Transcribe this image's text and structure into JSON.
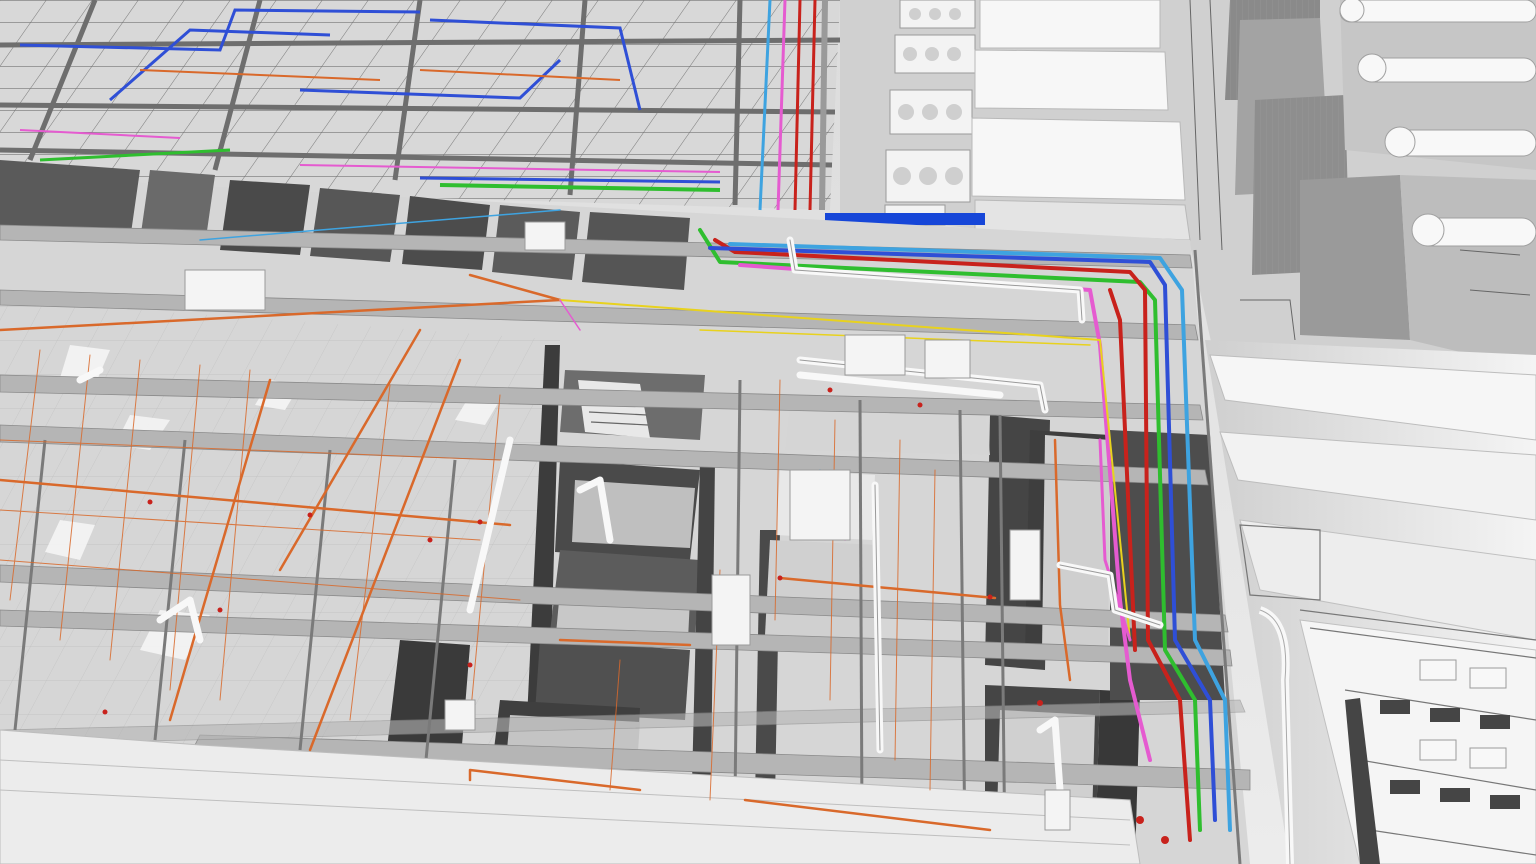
{
  "scene": {
    "description_hidden": "",
    "palette": {
      "background": "#e6e6e6",
      "slab": "#d2d2d2",
      "beam": "#b4b4b4",
      "beam_dark": "#8a8a8a",
      "wall_dark": "#3e3e3e",
      "wall_mid": "#6a6a6a",
      "equipment": "#f2f2f2",
      "pipe_orange": "#d9692b",
      "pipe_red": "#c8221c",
      "pipe_green": "#2fbe2f",
      "pipe_blue": "#2f4fd6",
      "pipe_lightblue": "#3ea3e0",
      "pipe_magenta": "#e55bd0",
      "pipe_yellow": "#e8d21e",
      "pipe_white": "#f7f7f7",
      "duct_blue": "#1646d8"
    }
  }
}
